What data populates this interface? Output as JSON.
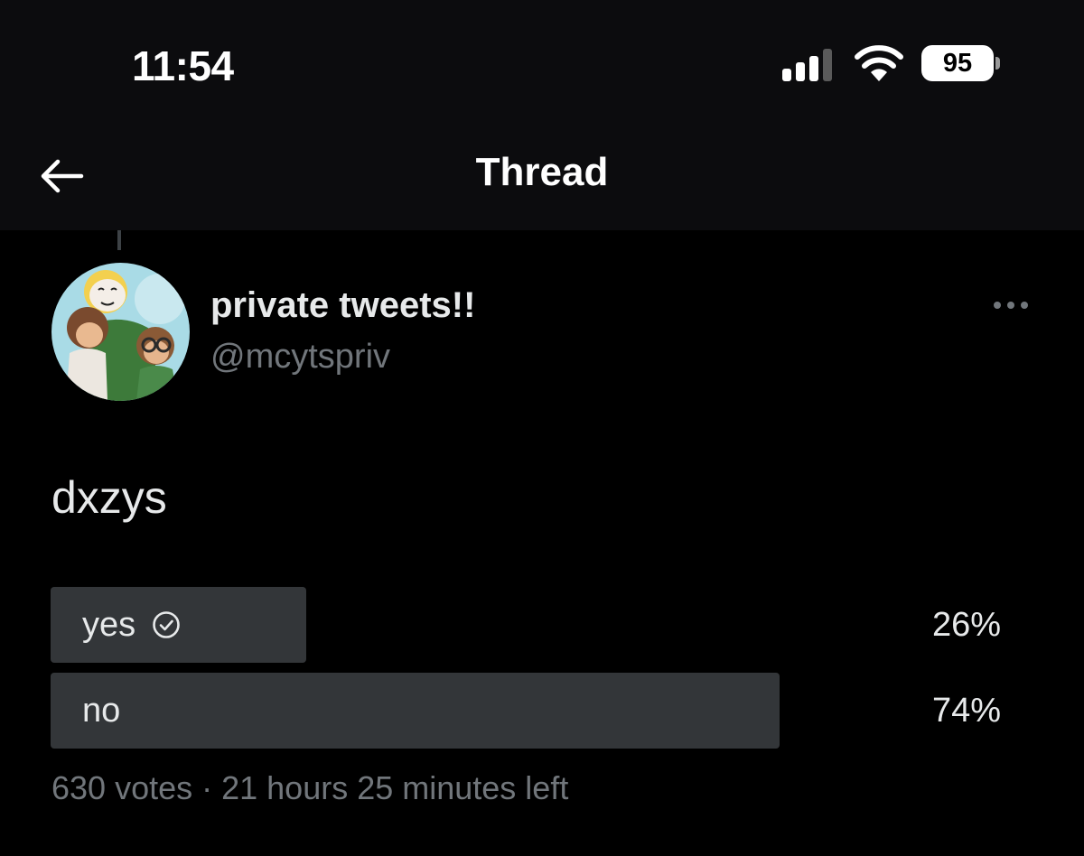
{
  "status_bar": {
    "time": "11:54",
    "battery_level": "95",
    "signal_bars_filled": 3,
    "signal_bars_total": 4
  },
  "nav": {
    "title": "Thread",
    "back_icon": "arrow-left-icon"
  },
  "tweet": {
    "author": {
      "display_name": "private tweets!!",
      "handle": "@mcytspriv"
    },
    "text": "dxzys",
    "more_icon": "more-horizontal-icon"
  },
  "poll": {
    "options": [
      {
        "label": "yes",
        "percent_label": "26%",
        "fraction": 0.26,
        "selected": true
      },
      {
        "label": "no",
        "percent_label": "74%",
        "fraction": 0.74,
        "selected": false
      }
    ],
    "meta": "630 votes · 21 hours 25 minutes left"
  },
  "colors": {
    "background": "#000000",
    "bar_background": "#0c0c0e",
    "primary_text": "#e7e9ea",
    "secondary_text": "#71767b",
    "poll_fill": "#333639"
  }
}
